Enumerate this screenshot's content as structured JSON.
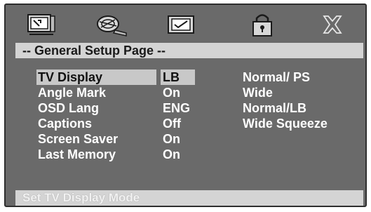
{
  "tabs": [
    {
      "icon": "tv-settings-icon"
    },
    {
      "icon": "film-reel-icon"
    },
    {
      "icon": "display-check-icon"
    },
    {
      "icon": "padlock-icon"
    },
    {
      "icon": "exit-x-icon"
    }
  ],
  "header": {
    "title": "-- General Setup Page --"
  },
  "settings": [
    {
      "label": "TV Display",
      "value": "LB"
    },
    {
      "label": "Angle Mark",
      "value": "On"
    },
    {
      "label": "OSD Lang",
      "value": "ENG"
    },
    {
      "label": "Captions",
      "value": "Off"
    },
    {
      "label": "Screen Saver",
      "value": "On"
    },
    {
      "label": "Last Memory",
      "value": "On"
    }
  ],
  "selected_index": 0,
  "options": [
    "Normal/ PS",
    "Wide",
    "Normal/LB",
    "Wide Squeeze"
  ],
  "status": {
    "text": "Set TV Display Mode"
  },
  "colors": {
    "panel": "#6a6a6a",
    "bar": "#d4d4d4",
    "text": "#ffffff"
  }
}
